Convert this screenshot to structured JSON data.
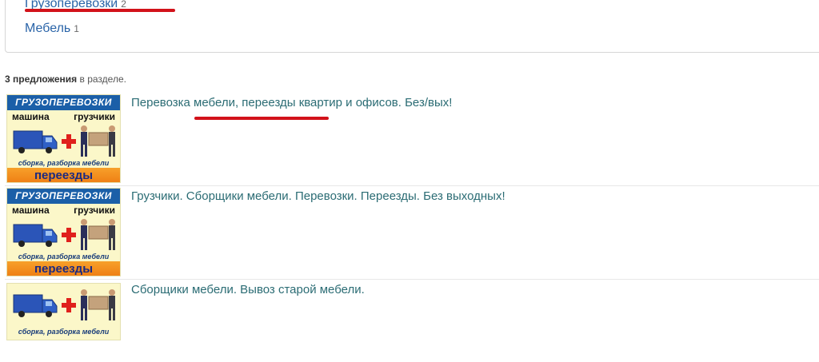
{
  "categories": [
    {
      "label": "Грузоперевозки",
      "count": "2"
    },
    {
      "label": "Мебель",
      "count": "1"
    }
  ],
  "summary": {
    "count_text": "3 предложения",
    "suffix": " в разделе."
  },
  "banner": {
    "title": "ГРУЗОПЕРЕВОЗКИ",
    "left_word": "машина",
    "right_word": "грузчики",
    "caption": "сборка, разборка мебели",
    "bottom": "переезды"
  },
  "listings": [
    {
      "title": "Перевозка мебели, переезды квартир и офисов. Без/вых!"
    },
    {
      "title": "Грузчики. Сборщики мебели. Перевозки. Переезды. Без выходных!"
    },
    {
      "title": "Сборщики мебели. Вывоз старой мебели."
    }
  ],
  "colors": {
    "link": "#2a64a8",
    "listing_title": "#2b6c74",
    "annotation_red": "#d2121a",
    "banner_blue": "#1b5fa8",
    "banner_orange": "#ee7d13",
    "banner_yellow": "#fbf7c9"
  },
  "icons": [
    "truck-icon",
    "plus-icon",
    "mover-icon"
  ]
}
